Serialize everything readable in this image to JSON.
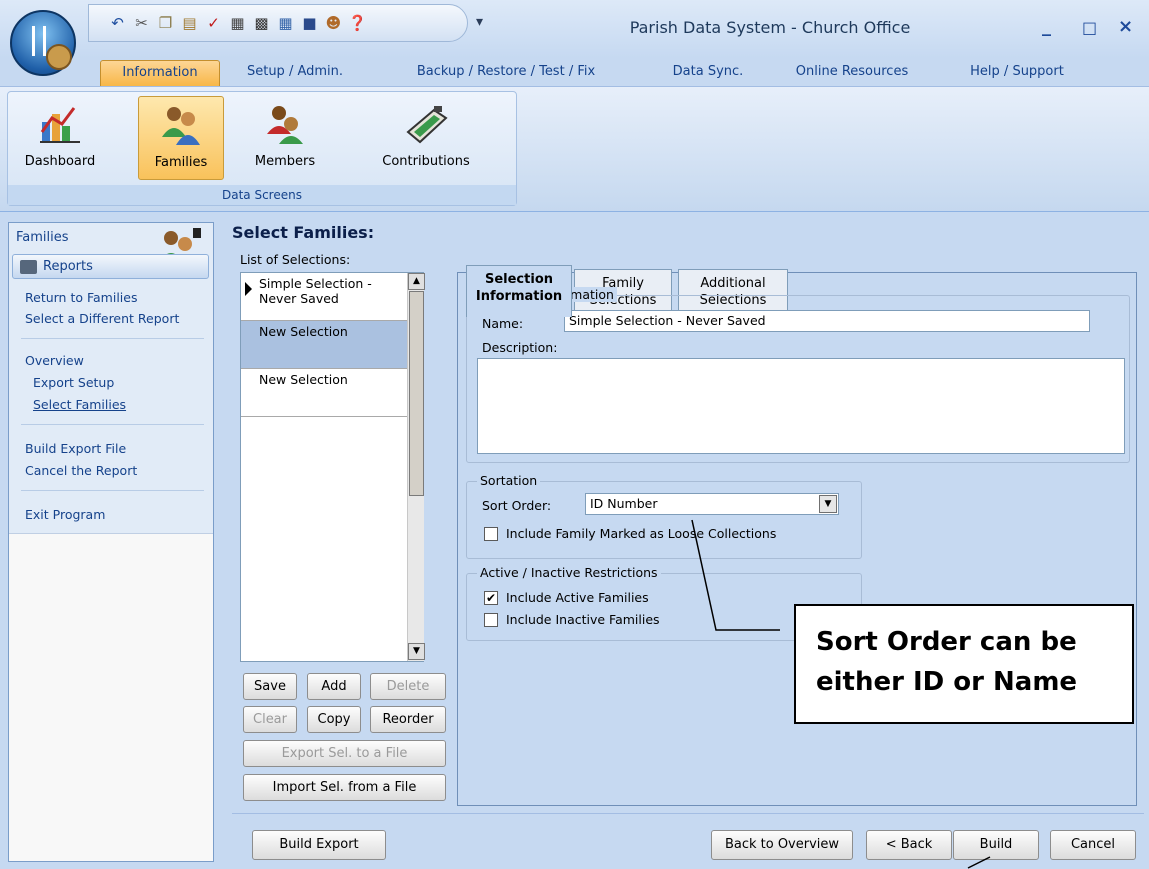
{
  "app": {
    "title": "Parish Data System - Church Office",
    "window_controls": [
      "_",
      "□",
      "×"
    ]
  },
  "quick_access": [
    "undo-icon",
    "cut-icon",
    "copy-icon",
    "paste-icon",
    "spellcheck-icon",
    "print-icon",
    "calculator-icon",
    "calendar-icon",
    "monitor-icon",
    "people-icon",
    "help-icon"
  ],
  "ribbon": {
    "tabs": [
      {
        "label": "Information",
        "active": true
      },
      {
        "label": "Setup / Admin."
      },
      {
        "label": "Backup / Restore / Test / Fix"
      },
      {
        "label": "Data Sync."
      },
      {
        "label": "Online Resources"
      },
      {
        "label": "Help / Support"
      }
    ],
    "group_label": "Data Screens",
    "buttons": [
      {
        "label": "Dashboard",
        "icon": "chart-icon"
      },
      {
        "label": "Families",
        "icon": "family-icon",
        "active": true
      },
      {
        "label": "Members",
        "icon": "member-icon"
      },
      {
        "label": "Contributions",
        "icon": "contributions-icon"
      }
    ]
  },
  "nav": {
    "title": "Families",
    "section": "Reports",
    "links": [
      "Return to Families",
      "Select a Different Report",
      "Overview",
      "Export Setup",
      "Select Families",
      "Build Export File",
      "Cancel the Report",
      "Exit Program"
    ]
  },
  "selections": {
    "title": "Select Families:",
    "list_label": "List of Selections:",
    "items": [
      "Simple Selection - Never Saved",
      "New Selection",
      "New Selection"
    ],
    "buttons": {
      "save": "Save",
      "add": "Add",
      "delete": "Delete",
      "clear": "Clear",
      "copy": "Copy",
      "reorder": "Reorder",
      "export": "Export Sel. to a File",
      "import": "Import  Sel. from a File"
    }
  },
  "tabs": [
    {
      "line1": "Selection",
      "line2": "Information",
      "active": true
    },
    {
      "line1": "Family",
      "line2": "Selections"
    },
    {
      "line1": "Additional",
      "line2": "Selections"
    }
  ],
  "selection_info": {
    "group": "Selection Information",
    "name_label": "Name:",
    "name_value": "Simple Selection - Never Saved",
    "description_label": "Description:",
    "description_value": ""
  },
  "sortation": {
    "group": "Sortation",
    "sort_label": "Sort Order:",
    "sort_value": "ID Number",
    "loose_label": "Include Family Marked as Loose Collections",
    "loose_checked": false
  },
  "restrictions": {
    "group": "Active / Inactive Restrictions",
    "active_label": "Include Active Families",
    "active_checked": true,
    "inactive_label": "Include Inactive Families",
    "inactive_checked": false
  },
  "footer": {
    "build_export": "Build Export",
    "back_overview": "Back to Overview",
    "back": "< Back",
    "build": "Build",
    "cancel": "Cancel"
  },
  "callout": {
    "line1": "Sort Order can be",
    "line2": "either ID or Name"
  }
}
